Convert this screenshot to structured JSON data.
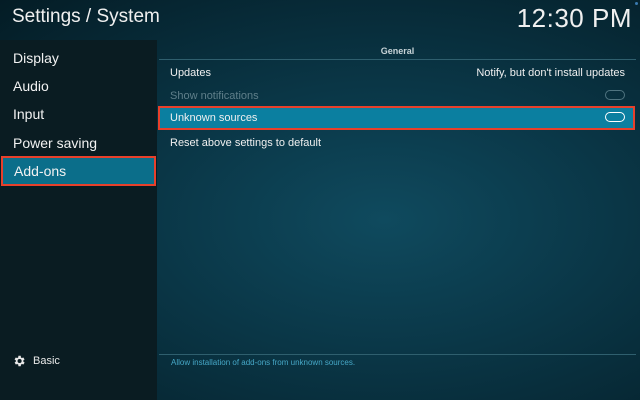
{
  "header": {
    "title": "Settings / System",
    "clock": "12:30 PM"
  },
  "sidebar": {
    "items": [
      {
        "label": "Display"
      },
      {
        "label": "Audio"
      },
      {
        "label": "Input"
      },
      {
        "label": "Power saving"
      },
      {
        "label": "Add-ons",
        "selected": true
      }
    ],
    "level_label": "Basic"
  },
  "main": {
    "section_title": "General",
    "settings": [
      {
        "label": "Updates",
        "value": "Notify, but don't install updates"
      },
      {
        "label": "Show notifications",
        "value": "off",
        "disabled": true
      },
      {
        "label": "Unknown sources",
        "value": "off",
        "focused": true
      },
      {
        "label": "Reset above settings to default"
      }
    ],
    "help_text": "Allow installation of add-ons from unknown sources."
  },
  "colors": {
    "accent": "#0b7fa0",
    "highlight_border": "#e8402b",
    "sidebar_bg": "#0a1c22"
  }
}
